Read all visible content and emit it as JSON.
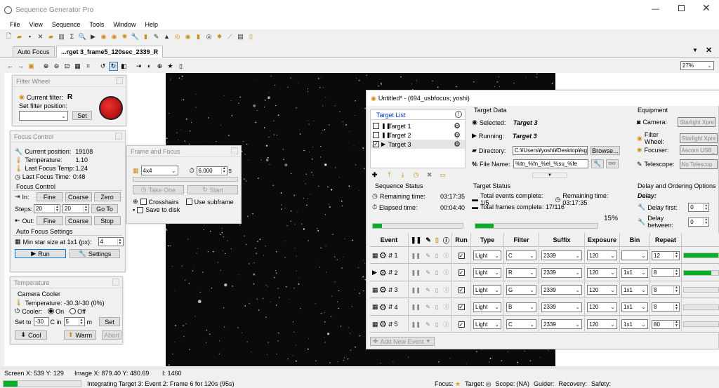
{
  "window": {
    "title": "Sequence Generator Pro"
  },
  "menu": [
    "File",
    "View",
    "Sequence",
    "Tools",
    "Window",
    "Help"
  ],
  "tabs": [
    "Auto Focus",
    "...rget 3_frame5_120sec_2339_R"
  ],
  "zoom": "27%",
  "filter_wheel": {
    "title": "Filter Wheel",
    "current_label": "Current filter:",
    "current_value": "R",
    "set_label": "Set filter position:",
    "set_button": "Set"
  },
  "focus_control": {
    "title": "Focus Control",
    "position_label": "Current position:",
    "position": "19108",
    "temp_label": "Temperature:",
    "temp": "1.10",
    "last_temp_label": "Last Focus Temp:",
    "last_temp": "1.24",
    "last_time_label": "Last Focus Time:",
    "last_time": "0:48",
    "section": "Focus Control",
    "in_label": "In:",
    "fine": "Fine",
    "coarse": "Coarse",
    "zero": "Zero",
    "steps_label": "Steps:",
    "steps1": "20",
    "steps2": "20",
    "goto": "Go To",
    "out_label": "Out:",
    "stop": "Stop",
    "af_section": "Auto Focus Settings",
    "min_star_label": "Min star size at 1x1 (px):",
    "min_star": "4",
    "run": "Run",
    "settings": "Settings"
  },
  "temperature": {
    "title": "Temperature",
    "cooler_section": "Camera Cooler",
    "temp_label": "Temperature: -30.3/-30 (0%)",
    "cooler_label": "Cooler:",
    "on": "On",
    "off": "Off",
    "setto_label": "Set to",
    "setto_value": "-30",
    "c_in": "C in",
    "minutes": "5",
    "m": "m",
    "set_button": "Set",
    "cool": "Cool",
    "warm": "Warm",
    "abort": "Abort"
  },
  "frame_focus": {
    "title": "Frame and Focus",
    "bin": "4x4",
    "exposure": "6.000",
    "sec": "s",
    "take_one": "Take One",
    "start": "Start",
    "crosshairs": "Crosshairs",
    "subframe": "Use subframe",
    "save": "Save to disk"
  },
  "sequence": {
    "title": "Untitled* - (694_usbfocus; yoshi)",
    "target_list_label": "Target List",
    "targets": [
      {
        "name": "Target 1",
        "checked": false,
        "running": false
      },
      {
        "name": "Target 2",
        "checked": false,
        "running": false
      },
      {
        "name": "Target 3",
        "checked": true,
        "running": true
      }
    ],
    "target_data": {
      "header": "Target Data",
      "selected_label": "Selected:",
      "selected": "Target 3",
      "running_label": "Running:",
      "running": "Target 3",
      "directory_label": "Directory:",
      "directory": "C:¥Users¥yoshi¥Desktop¥sg",
      "browse": "Browse...",
      "filename_label": "File Name:",
      "filename": "%tn_%fn_%el_%su_%fe"
    },
    "equipment": {
      "header": "Equipment",
      "camera_label": "Camera:",
      "camera": "Starlight Xpre",
      "fw_label": "Filter Wheel:",
      "fw": "Starlight Xpre",
      "focuser_label": "Focuser:",
      "focuser": "Ascom USB_",
      "telescope_label": "Telescope:",
      "telescope": "No Telescop"
    },
    "seq_status": {
      "header": "Sequence Status",
      "remaining_label": "Remaining time:",
      "remaining": "03:17:35",
      "elapsed_label": "Elapsed time:",
      "elapsed": "00:04:40",
      "progress": 0.1
    },
    "target_status": {
      "header": "Target Status",
      "events_label": "Total events complete: 1/5",
      "remaining_label": "Remaining time: 03:17:35",
      "frames_label": "Total frames complete: 17/116",
      "percent": "15%",
      "progress": 0.15
    },
    "delay": {
      "header": "Delay and Ordering Options",
      "delay_label": "Delay:",
      "first_label": "Delay first:",
      "first": "0",
      "between_label": "Delay between:",
      "between": "0"
    },
    "columns": [
      "Event",
      "Run",
      "Type",
      "Filter",
      "Suffix",
      "Exposure",
      "Bin",
      "Repeat"
    ],
    "events": [
      {
        "type": "Light",
        "filter": "C",
        "suffix": "2339",
        "exposure": "120",
        "bin": "",
        "repeat": "12",
        "progress": 1.0,
        "running": false
      },
      {
        "type": "Light",
        "filter": "R",
        "suffix": "2339",
        "exposure": "120",
        "bin": "1x1",
        "repeat": "8",
        "progress": 0.8,
        "running": true
      },
      {
        "type": "Light",
        "filter": "G",
        "suffix": "2339",
        "exposure": "120",
        "bin": "1x1",
        "repeat": "8",
        "progress": 0.0,
        "running": false
      },
      {
        "type": "Light",
        "filter": "B",
        "suffix": "2339",
        "exposure": "120",
        "bin": "1x1",
        "repeat": "8",
        "progress": 0.0,
        "running": false
      },
      {
        "type": "Light",
        "filter": "C",
        "suffix": "2339",
        "exposure": "120",
        "bin": "1x1",
        "repeat": "80",
        "progress": 0.0,
        "running": false
      }
    ],
    "add_event": "Add New Event"
  },
  "statusbar": {
    "screen": "Screen X: 539 Y: 129",
    "image": "Image X: 879.40 Y: 480.69",
    "intensity": "I: 1460",
    "progress_text": "Integrating Target 3: Event 2: Frame 6 for 120s (95s)",
    "focus": "Focus:",
    "target": "Target:",
    "scope": "Scope:",
    "na": "(NA)",
    "guider": "Guider:",
    "recovery": "Recovery:",
    "safety": "Safety:"
  },
  "colors": {
    "accent": "#06b025",
    "link_blue": "#0033cc",
    "image_bg": "#0a0a0a"
  }
}
